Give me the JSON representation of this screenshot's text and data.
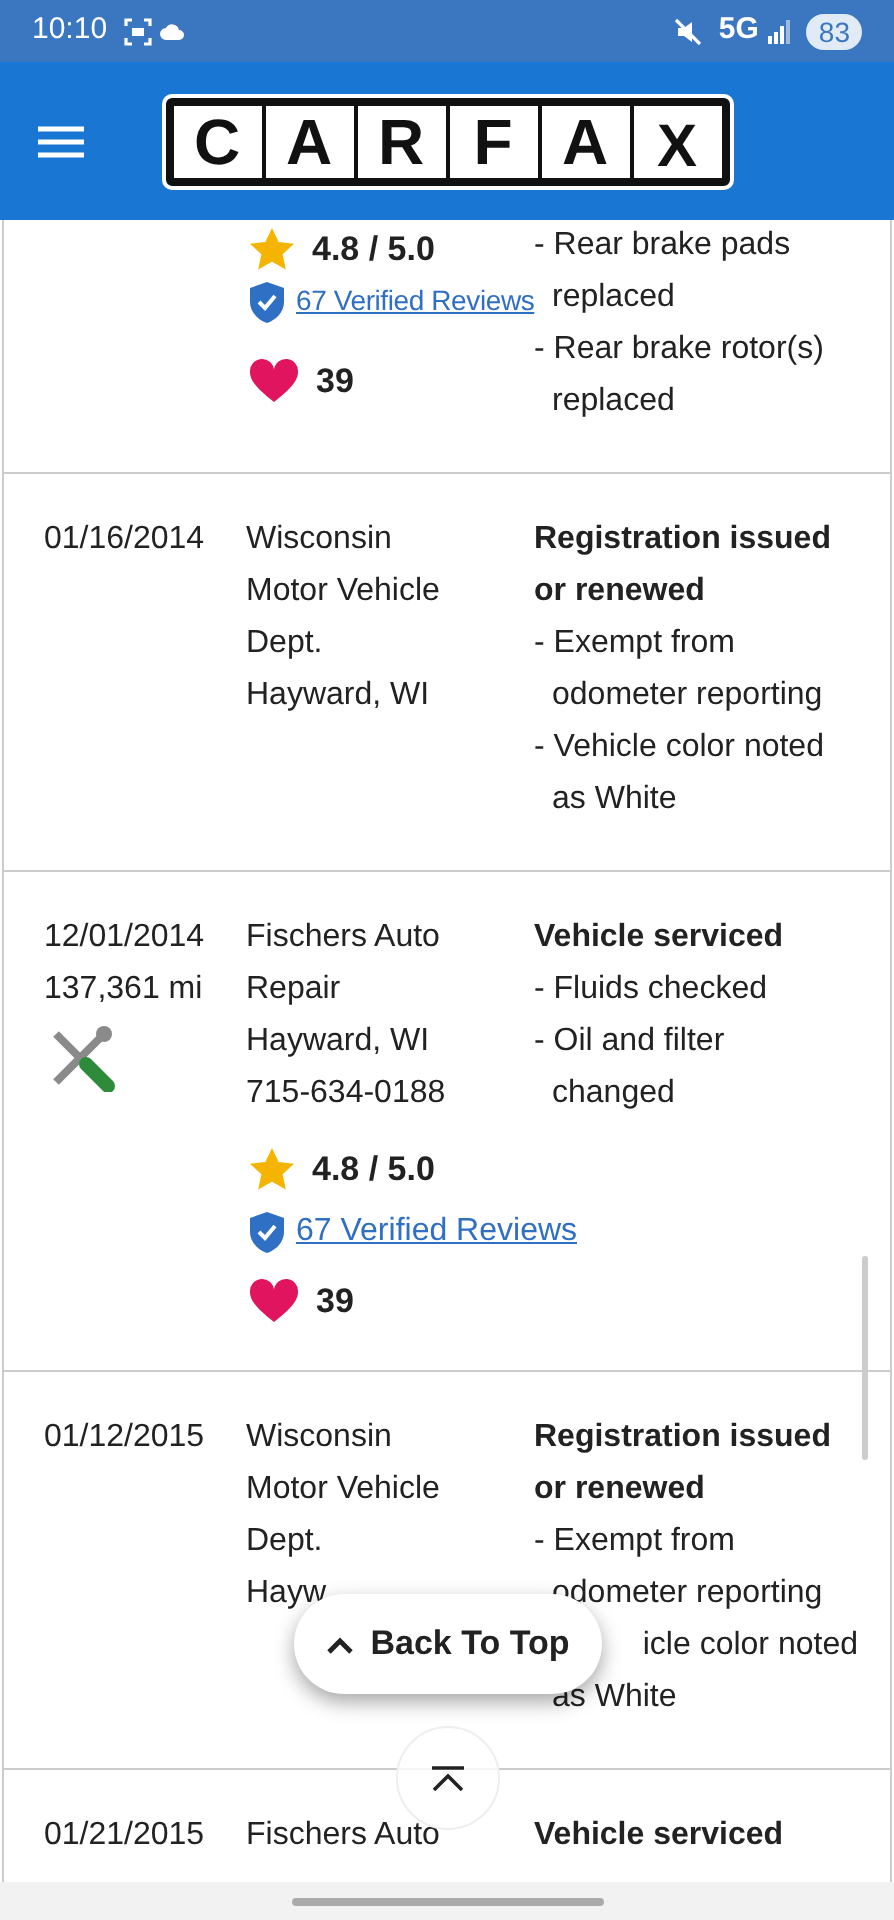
{
  "status_bar": {
    "time": "10:10",
    "network": "5G",
    "battery": "83"
  },
  "header": {
    "logo_letters": [
      "C",
      "A",
      "R",
      "F",
      "A",
      "X"
    ]
  },
  "records": [
    {
      "details": [
        {
          "kind": "item",
          "text": "- Rear brake pads"
        },
        {
          "kind": "cont",
          "text": "replaced"
        },
        {
          "kind": "item",
          "text": "- Rear brake rotor(s)"
        },
        {
          "kind": "cont",
          "text": "replaced"
        }
      ],
      "rating": {
        "score": "4.8 / 5.0",
        "reviews": "67 Verified Reviews",
        "likes": "39"
      }
    },
    {
      "date": "01/16/2014",
      "provider": [
        "Wisconsin",
        "Motor Vehicle",
        "Dept.",
        "Hayward, WI"
      ],
      "title": "Registration issued or renewed",
      "details": [
        {
          "kind": "item",
          "text": "- Exempt from"
        },
        {
          "kind": "cont",
          "text": "odometer reporting"
        },
        {
          "kind": "item",
          "text": "- Vehicle color noted"
        },
        {
          "kind": "cont",
          "text": "as White"
        }
      ]
    },
    {
      "date": "12/01/2014",
      "mileage": "137,361 mi",
      "tool_icon": true,
      "provider": [
        "Fischers Auto",
        "Repair",
        "Hayward, WI",
        "715-634-0188"
      ],
      "title": "Vehicle serviced",
      "details": [
        {
          "kind": "item",
          "text": "- Fluids checked"
        },
        {
          "kind": "item",
          "text": "- Oil and filter"
        },
        {
          "kind": "cont",
          "text": "changed"
        }
      ],
      "rating": {
        "score": "4.8 / 5.0",
        "reviews": "67 Verified Reviews",
        "likes": "39"
      }
    },
    {
      "date": "01/12/2015",
      "provider": [
        "Wisconsin",
        "Motor Vehicle",
        "Dept.",
        "Hayw"
      ],
      "title": "Registration issued or renewed",
      "details": [
        {
          "kind": "item",
          "text": "- Exempt from"
        },
        {
          "kind": "cont",
          "text": "odometer reporting"
        },
        {
          "kind": "partial",
          "text": "icle color noted"
        },
        {
          "kind": "cont",
          "text": "as White"
        }
      ]
    },
    {
      "date": "01/21/2015",
      "provider": [
        "Fischers Auto"
      ],
      "title": "Vehicle serviced"
    }
  ],
  "back_to_top": {
    "label": "Back To Top"
  }
}
